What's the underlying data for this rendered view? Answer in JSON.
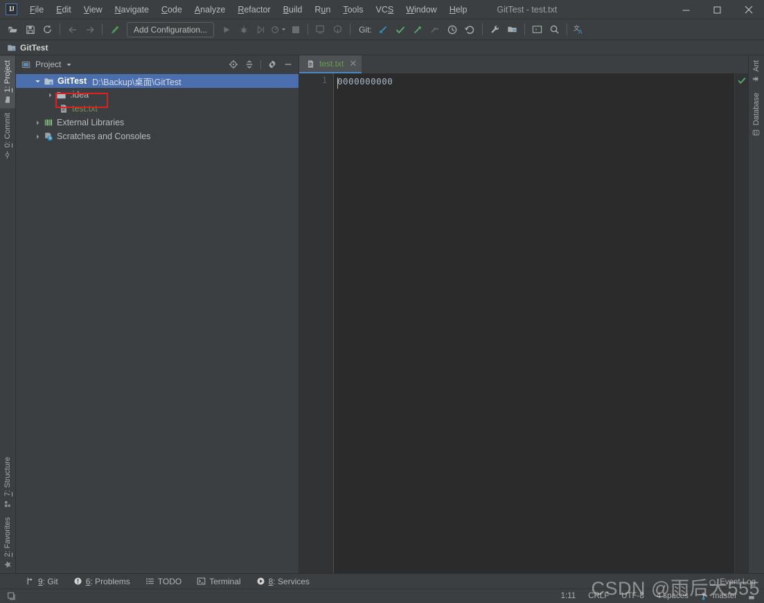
{
  "window": {
    "title": "GitTest - test.txt",
    "logo_text": "IJ",
    "controls": {
      "minimize": "—",
      "maximize": "☐",
      "close": "✕"
    }
  },
  "menubar": {
    "items": [
      {
        "label": "File",
        "mnemonic": "F"
      },
      {
        "label": "Edit",
        "mnemonic": "E"
      },
      {
        "label": "View",
        "mnemonic": "V"
      },
      {
        "label": "Navigate",
        "mnemonic": "N"
      },
      {
        "label": "Code",
        "mnemonic": "C"
      },
      {
        "label": "Analyze",
        "mnemonic": "A"
      },
      {
        "label": "Refactor",
        "mnemonic": "R"
      },
      {
        "label": "Build",
        "mnemonic": "B"
      },
      {
        "label": "Run",
        "mnemonic": "u"
      },
      {
        "label": "Tools",
        "mnemonic": "T"
      },
      {
        "label": "VCS",
        "mnemonic": "S"
      },
      {
        "label": "Window",
        "mnemonic": "W"
      },
      {
        "label": "Help",
        "mnemonic": "H"
      }
    ]
  },
  "toolbar": {
    "open_title": "open-project",
    "save_title": "save-all",
    "sync_title": "synchronize",
    "back_title": "navigate-back",
    "forward_title": "navigate-forward",
    "build_title": "build-project",
    "run_config_label": "Add Configuration...",
    "run_title": "run",
    "debug_title": "debug",
    "run_coverage_title": "run-with-coverage",
    "profiler_title": "profiler",
    "stop_title": "stop",
    "git_label": "Git:",
    "git_update_title": "update-project",
    "git_commit_title": "commit",
    "git_push_title": "push",
    "git_merge_title": "merge",
    "git_history_title": "show-history",
    "git_rollback_title": "rollback",
    "settings_title": "settings",
    "project_structure_title": "project-structure",
    "terminal_title": "terminal",
    "search_title": "search-everywhere",
    "translate_title": "translate"
  },
  "navbar": {
    "project_name": "GitTest"
  },
  "project_panel": {
    "title": "Project",
    "dropdown_icon": "chevron-down-icon",
    "tools": {
      "locate": "select-opened-file",
      "collapse": "collapse-all",
      "settings": "gear-icon",
      "hide": "hide-panel"
    },
    "tree": [
      {
        "label": "GitTest",
        "path": "D:\\Backup\\桌面\\GitTest",
        "arrow": "⌄",
        "indent": 10,
        "bold": true,
        "selected": true,
        "icon": "project-folder-icon"
      },
      {
        "label": ".idea",
        "path": "",
        "arrow": "›",
        "indent": 28,
        "bold": false,
        "selected": false,
        "icon": "folder-icon"
      },
      {
        "label": "test.txt",
        "path": "",
        "arrow": "",
        "indent": 46,
        "bold": false,
        "selected": false,
        "icon": "text-file-icon",
        "highlighted": true
      },
      {
        "label": "External Libraries",
        "path": "",
        "arrow": "›",
        "indent": 10,
        "bold": false,
        "selected": false,
        "icon": "libraries-icon"
      },
      {
        "label": "Scratches and Consoles",
        "path": "",
        "arrow": "›",
        "indent": 10,
        "bold": false,
        "selected": false,
        "icon": "scratches-icon"
      }
    ]
  },
  "editor": {
    "tab": {
      "label": "test.txt",
      "close": "✕",
      "icon": "text-file-icon"
    },
    "line_numbers": [
      "1"
    ],
    "lines": [
      "0000000000"
    ],
    "inspection_status": "✔"
  },
  "left_strip": {
    "top": [
      {
        "label": "1: Project",
        "mnemonic": "1",
        "icon": "project-icon",
        "active": true
      },
      {
        "label": "0: Commit",
        "mnemonic": "0",
        "icon": "commit-icon",
        "active": false
      }
    ],
    "bottom": [
      {
        "label": "7: Structure",
        "mnemonic": "7",
        "icon": "structure-icon",
        "active": false
      },
      {
        "label": "2: Favorites",
        "mnemonic": "2",
        "icon": "star-icon",
        "active": false
      }
    ]
  },
  "right_strip": {
    "top": [
      {
        "label": "Ant",
        "icon": "ant-icon"
      },
      {
        "label": "Database",
        "icon": "database-icon"
      }
    ]
  },
  "bottom_bar": {
    "items": [
      {
        "label": "9: Git",
        "mnemonic": "9",
        "icon": "git-branch-icon"
      },
      {
        "label": "6: Problems",
        "mnemonic": "6",
        "icon": "problems-icon"
      },
      {
        "label": "TODO",
        "mnemonic": "",
        "icon": "todo-icon"
      },
      {
        "label": "Terminal",
        "mnemonic": "",
        "icon": "terminal-icon"
      },
      {
        "label": "8: Services",
        "mnemonic": "8",
        "icon": "services-icon"
      }
    ]
  },
  "status_bar": {
    "caret_position": "1:11",
    "line_separator": "CRLF",
    "encoding": "UTF-8",
    "indent": "4 spaces",
    "branch": "master",
    "event_log": "Event Log",
    "lock_icon": "read-only-toggle"
  },
  "watermark": {
    "text": "CSDN @雨后大555"
  },
  "colors": {
    "accent_selection": "#4b6eaf",
    "panel_bg": "#3c3f41",
    "editor_bg": "#2b2b2b",
    "gutter_bg": "#313335",
    "file_green": "#6a9c4f",
    "highlight_red": "#e02020",
    "inspect_green": "#59a869",
    "git_blue": "#3592c4",
    "git_green": "#59a869"
  }
}
